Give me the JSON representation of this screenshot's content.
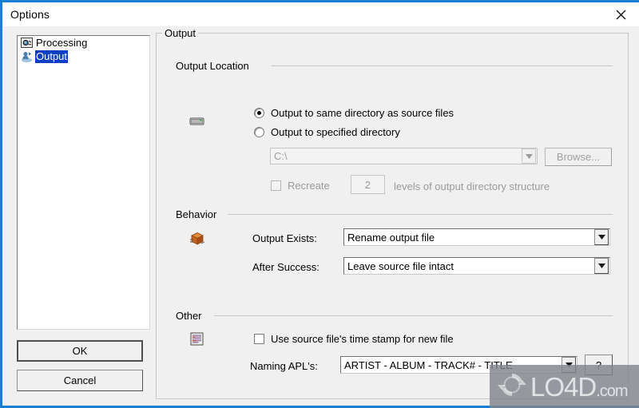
{
  "window": {
    "title": "Options",
    "close_icon": "close-icon",
    "border_color": "#1a7fd4"
  },
  "sidebar": {
    "items": [
      {
        "label": "Processing",
        "icon": "processing-gear-icon",
        "selected": false
      },
      {
        "label": "Output",
        "icon": "output-person-icon",
        "selected": true
      }
    ]
  },
  "buttons": {
    "ok": "OK",
    "cancel": "Cancel"
  },
  "main": {
    "group_title": "Output",
    "sections": {
      "output_location": {
        "title": "Output Location",
        "icon": "disk-drive-icon",
        "radio_same_dir": {
          "label": "Output to same directory as source files",
          "checked": true
        },
        "radio_specified_dir": {
          "label": "Output to specified directory",
          "checked": false
        },
        "directory_combo": {
          "value": "C:\\",
          "disabled": true
        },
        "browse_button": {
          "label": "Browse...",
          "disabled": true
        },
        "recreate_checkbox": {
          "label": "Recreate",
          "checked": false,
          "disabled": true
        },
        "levels_value": "2",
        "levels_label": "levels of output directory structure"
      },
      "behavior": {
        "title": "Behavior",
        "icon": "package-box-icon",
        "rows": [
          {
            "label": "Output Exists:",
            "value": "Rename output file"
          },
          {
            "label": "After Success:",
            "value": "Leave source file intact"
          }
        ]
      },
      "other": {
        "title": "Other",
        "icon": "document-list-icon",
        "timestamp_checkbox": {
          "label": "Use source file's time stamp for new file",
          "checked": false
        },
        "naming_label": "Naming APL's:",
        "naming_value": "ARTIST - ALBUM - TRACK# - TITLE",
        "help_button": "?"
      }
    }
  },
  "watermark": {
    "name": "LO4D",
    "suffix": ".com"
  }
}
